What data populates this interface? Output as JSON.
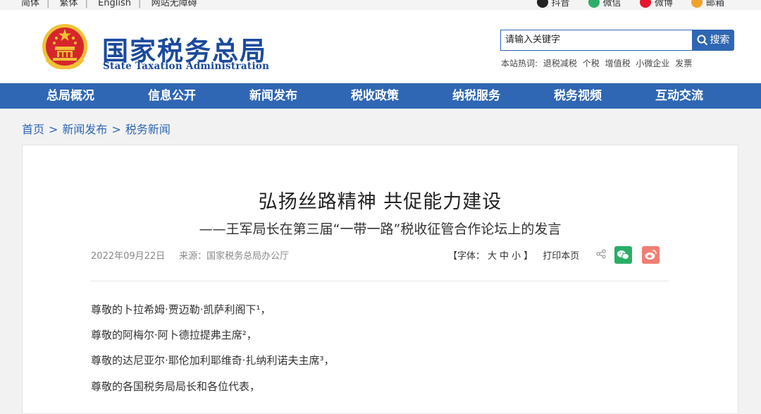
{
  "topbar": {
    "links": [
      "简体",
      "繁体",
      "English",
      "网站无障碍"
    ],
    "social": [
      {
        "label": "抖音",
        "icon": "douyin-icon",
        "color": "#222222"
      },
      {
        "label": "微信",
        "icon": "wechat-icon",
        "color": "#2aae67"
      },
      {
        "label": "微博",
        "icon": "weibo-icon",
        "color": "#e6162d"
      },
      {
        "label": "邮箱",
        "icon": "mail-icon",
        "color": "#f0a22e"
      }
    ]
  },
  "header": {
    "name_cn": "国家税务总局",
    "name_en": "State Taxation Administration"
  },
  "search": {
    "placeholder": "请输入关键字",
    "button": "搜索",
    "hot_label": "本站热词:",
    "hot_words": [
      "退税减税",
      "个税",
      "增值税",
      "小微企业",
      "发票"
    ]
  },
  "nav": [
    "总局概况",
    "信息公开",
    "新闻发布",
    "税收政策",
    "纳税服务",
    "税务视频",
    "互动交流"
  ],
  "breadcrumb": [
    "首页",
    "新闻发布",
    "税务新闻"
  ],
  "article": {
    "title": "弘扬丝路精神 共促能力建设",
    "subtitle": "——王军局长在第三届“一带一路”税收征管合作论坛上的发言",
    "date": "2022年09月22日",
    "source": "来源：国家税务总局办公厅",
    "font_label": "【字体：",
    "font_sizes": [
      "大",
      "中",
      "小"
    ],
    "font_close": "】",
    "print": "打印本页",
    "paragraphs": [
      "尊敬的卜拉希姆·贾迈勒·凯萨利阁下¹，",
      "尊敬的阿梅尔·阿卜德拉提弗主席²，",
      "尊敬的达尼亚尔·耶伦加利耶维奇·扎纳利诺夫主席³，",
      "尊敬的各国税务局局长和各位代表，"
    ]
  },
  "colors": {
    "brand_blue": "#2f67b4",
    "logo_blue": "#1b4a9c",
    "emblem_red": "#d6262b",
    "emblem_gold": "#f2c037"
  }
}
